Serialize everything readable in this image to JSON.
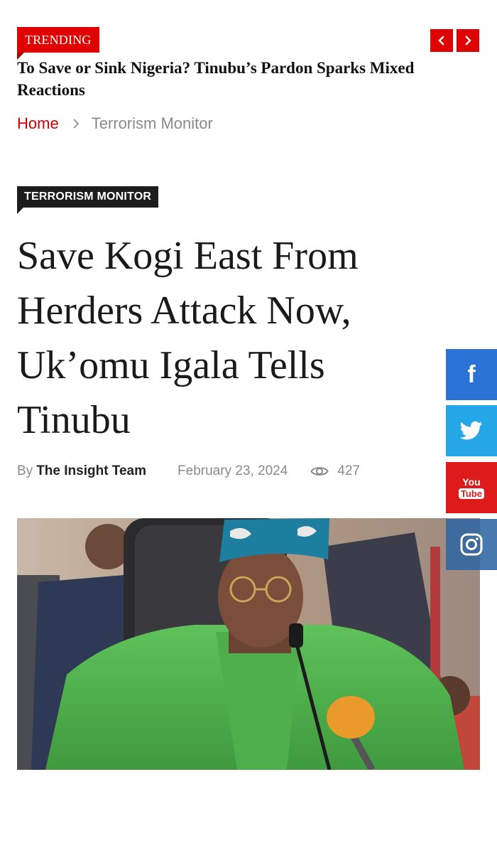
{
  "trending": {
    "label": "TRENDING",
    "headline": "To Save or Sink Nigeria? Tinubu’s Pardon Sparks Mixed Reactions"
  },
  "breadcrumb": {
    "home": "Home",
    "current": "Terrorism Monitor"
  },
  "article": {
    "category": "TERRORISM MONITOR",
    "title": "Save Kogi East From Herders Attack Now, Uk’omu Igala Tells Tinubu",
    "by_label": "By",
    "author": "The Insight Team",
    "date": "February 23, 2024",
    "views": "427"
  },
  "social": {
    "facebook_label": "f",
    "youtube_top": "You",
    "youtube_bottom": "Tube"
  },
  "colors": {
    "accent": "#e00000",
    "category_badge": "#1c1c1c",
    "facebook": "#2a72d6",
    "twitter": "#25a6e6",
    "youtube": "#dd1b1b",
    "instagram": "#3066a0"
  },
  "icons": [
    "chevron-left-icon",
    "chevron-right-icon",
    "breadcrumb-chevron-icon",
    "eye-icon",
    "facebook-icon",
    "twitter-icon",
    "youtube-icon",
    "instagram-icon"
  ]
}
